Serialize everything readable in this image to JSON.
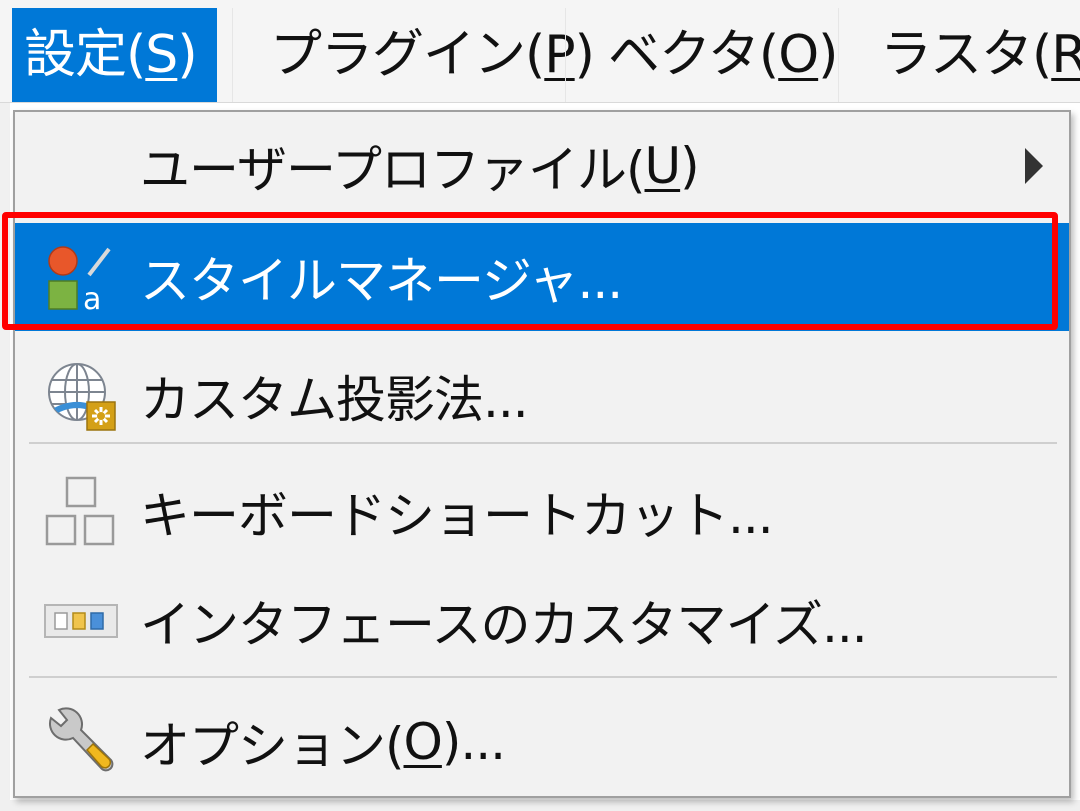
{
  "menubar": {
    "items": [
      {
        "text": "設定(",
        "acc": "S",
        "end": ")"
      },
      {
        "text": "プラグイン(",
        "acc": "P",
        "end": ")"
      },
      {
        "text": "ベクタ(",
        "acc": "O",
        "end": ")"
      },
      {
        "text": "ラスタ(",
        "acc": "R",
        "end": ")"
      }
    ]
  },
  "menu": {
    "items": [
      {
        "text": "ユーザープロファイル(",
        "acc": "U",
        "end": ")",
        "icon": "none",
        "submenu": true
      },
      {
        "text": "スタイルマネージャ...",
        "icon": "style-manager-icon",
        "highlighted": true
      },
      {
        "text": "カスタム投影法...",
        "icon": "custom-projection-icon"
      },
      {
        "text": "キーボードショートカット...",
        "icon": "keyboard-shortcuts-icon"
      },
      {
        "text": "インタフェースのカスタマイズ...",
        "icon": "interface-customization-icon"
      },
      {
        "text": "オプション(",
        "acc": "O",
        "end": ")...",
        "icon": "wrench-icon"
      }
    ]
  },
  "colors": {
    "accent": "#0078d7",
    "highlight_frame": "#ff0000"
  }
}
